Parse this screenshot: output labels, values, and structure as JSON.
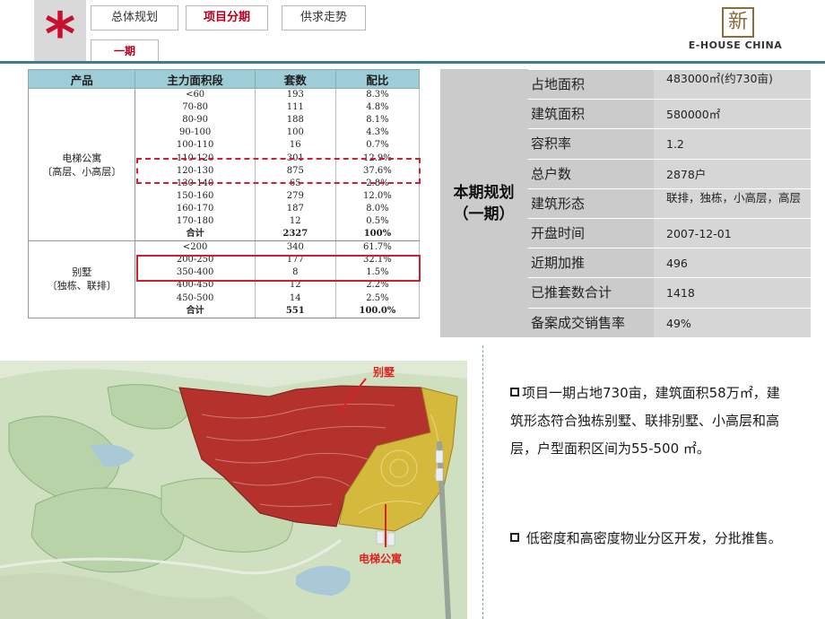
{
  "header": {
    "logo_char": "*",
    "tabs": [
      {
        "label": "总体规划"
      },
      {
        "label": "项目分期"
      },
      {
        "label": "供求走势"
      }
    ],
    "sub_tab": "一期",
    "brand_mark": "新",
    "brand_name": "E-HOUSE CHINA"
  },
  "units_table": {
    "headers": [
      "产品",
      "主力面积段",
      "套数",
      "配比"
    ],
    "groups": [
      {
        "name_line1": "电梯公寓",
        "name_line2": "〔高层、小高层〕",
        "rows": [
          [
            "<60",
            "193",
            "8.3%"
          ],
          [
            "70-80",
            "111",
            "4.8%"
          ],
          [
            "80-90",
            "188",
            "8.1%"
          ],
          [
            "90-100",
            "100",
            "4.3%"
          ],
          [
            "100-110",
            "16",
            "0.7%"
          ],
          [
            "110-120",
            "301",
            "12.9%"
          ],
          [
            "120-130",
            "875",
            "37.6%"
          ],
          [
            "130-140",
            "65",
            "2.8%"
          ],
          [
            "150-160",
            "279",
            "12.0%"
          ],
          [
            "160-170",
            "187",
            "8.0%"
          ],
          [
            "170-180",
            "12",
            "0.5%"
          ]
        ],
        "total": [
          "合计",
          "2327",
          "100%"
        ]
      },
      {
        "name_line1": "别墅",
        "name_line2": "〔独栋、联排〕",
        "rows": [
          [
            "<200",
            "340",
            "61.7%"
          ],
          [
            "200-250",
            "177",
            "32.1%"
          ],
          [
            "350-400",
            "8",
            "1.5%"
          ],
          [
            "400-450",
            "12",
            "2.2%"
          ],
          [
            "450-500",
            "14",
            "2.5%"
          ]
        ],
        "total": [
          "合计",
          "551",
          "100.0%"
        ]
      }
    ]
  },
  "plan": {
    "title_line1": "本期规划",
    "title_line2": "（一期）",
    "rows": [
      {
        "key": "占地面积",
        "value": "483000㎡(约730亩)"
      },
      {
        "key": "建筑面积",
        "value": "580000㎡"
      },
      {
        "key": "容积率",
        "value": "1.2"
      },
      {
        "key": "总户数",
        "value": "2878户"
      },
      {
        "key": "建筑形态",
        "value": "联排，独栋，小高层，高层"
      },
      {
        "key": "开盘时间",
        "value": "2007-12-01"
      },
      {
        "key": "近期加推",
        "value": "496"
      },
      {
        "key": "已推套数合计",
        "value": "1418"
      },
      {
        "key": "备案成交销售率",
        "value": "49%"
      }
    ]
  },
  "map": {
    "label_villa": "别墅",
    "label_apartment": "电梯公寓",
    "colors": {
      "villa": "#b5312c",
      "apartment": "#d4b93c",
      "land": "#cfe0c0",
      "water": "#a9c9d6"
    }
  },
  "description": {
    "para1": "项目一期占地730亩，建筑面积58万㎡，建筑形态符合独栋别墅、联排别墅、小高层和高层，户型面积区间为55-500 ㎡。",
    "para2": "低密度和高密度物业分区开发，分批推售。"
  }
}
